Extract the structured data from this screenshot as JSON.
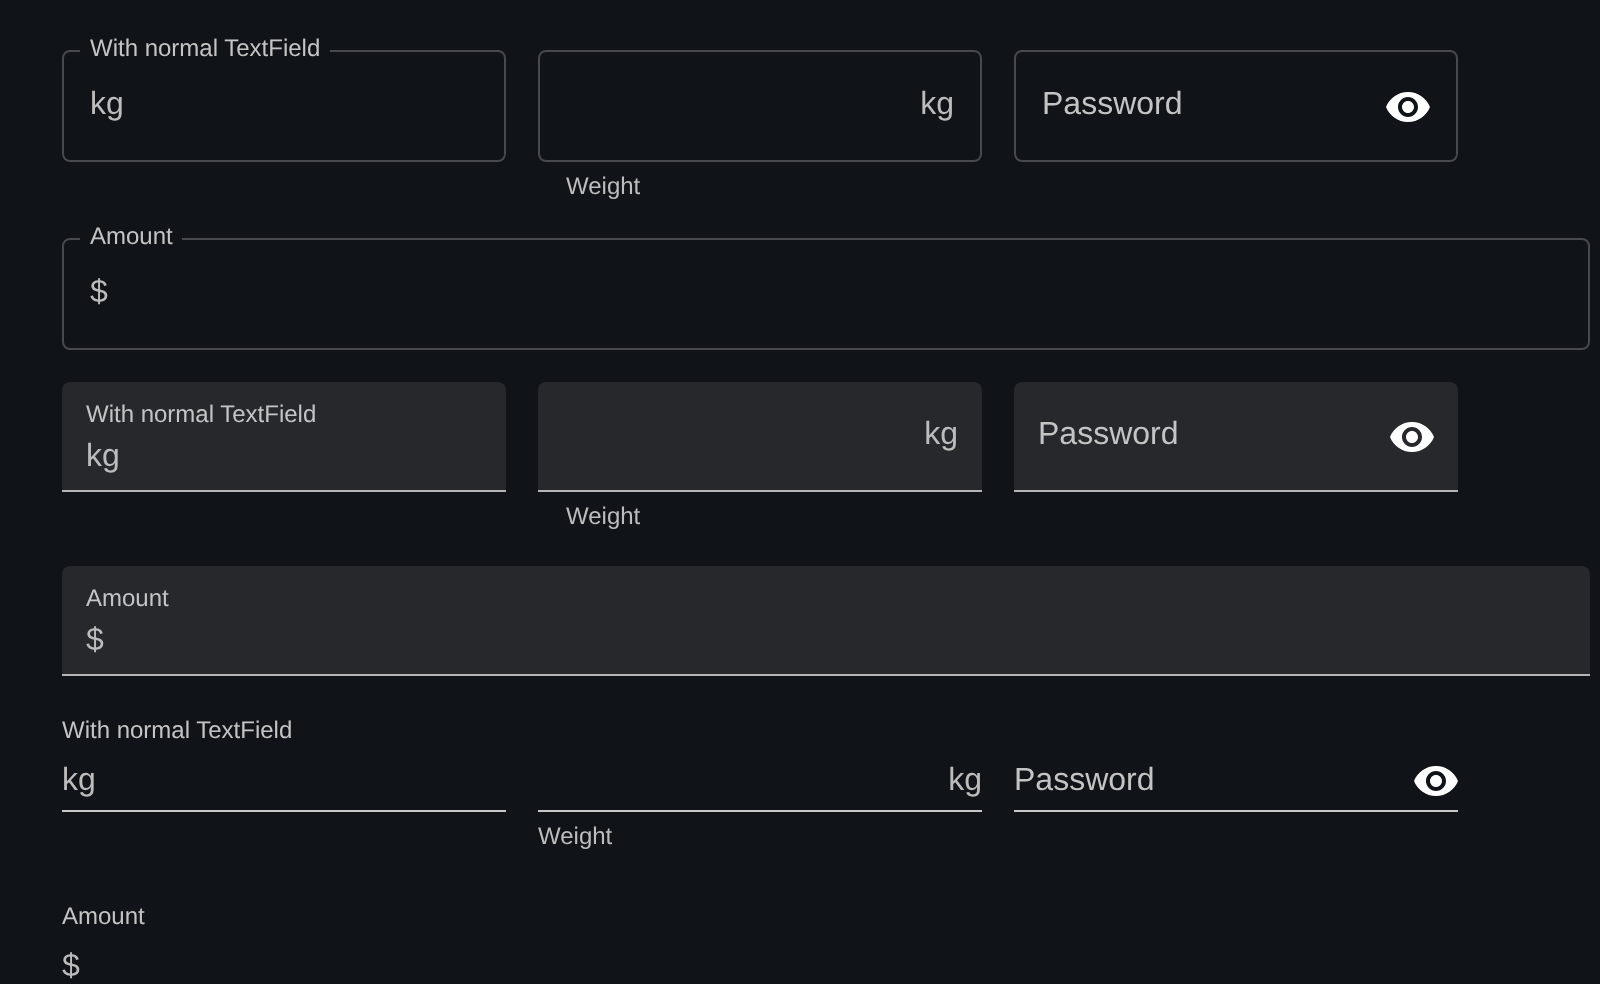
{
  "sections": [
    {
      "kind": "outlined",
      "fields": [
        {
          "kind": "labeled",
          "label": "With normal TextField",
          "adornment": "kg"
        },
        {
          "kind": "suffix",
          "adornment": "kg",
          "helper": "Weight"
        },
        {
          "kind": "password",
          "label": "Password"
        }
      ],
      "amount": {
        "label": "Amount",
        "adornment": "$"
      }
    },
    {
      "kind": "filled",
      "fields": [
        {
          "kind": "labeled",
          "label": "With normal TextField",
          "adornment": "kg"
        },
        {
          "kind": "suffix",
          "adornment": "kg",
          "helper": "Weight"
        },
        {
          "kind": "password",
          "label": "Password"
        }
      ],
      "amount": {
        "label": "Amount",
        "adornment": "$"
      }
    },
    {
      "kind": "standard",
      "fields": [
        {
          "kind": "labeled",
          "label": "With normal TextField",
          "adornment": "kg"
        },
        {
          "kind": "suffix",
          "adornment": "kg",
          "helper": "Weight"
        },
        {
          "kind": "password",
          "label": "Password"
        }
      ],
      "amount": {
        "label": "Amount",
        "adornment": "$"
      }
    }
  ]
}
